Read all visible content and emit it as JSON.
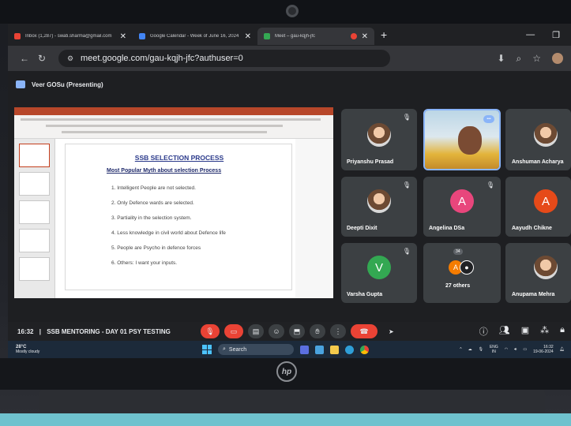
{
  "browser": {
    "tabs": [
      {
        "title": "Inbox (1,287) - swati.sharma@gmail.com",
        "favicon_color": "#ea4335",
        "active": false
      },
      {
        "title": "Google Calendar - Week of June 16, 2024",
        "favicon_color": "#4285f4",
        "active": false
      },
      {
        "title": "Meet – gau-kqjh-jfc",
        "favicon_color": "#34a853",
        "active": true
      }
    ],
    "close_glyph": "✕",
    "new_tab_glyph": "+",
    "window_controls": [
      "—",
      "❐"
    ],
    "url": "meet.google.com/gau-kqjh-jfc?authuser=0"
  },
  "meet": {
    "presenter_label": "Veer GOSu (Presenting)",
    "meeting_time": "16:32",
    "meeting_separator": "|",
    "meeting_name": "SSB MENTORING - DAY 01 PSY TESTING",
    "others_count_label": "27 others",
    "hand_count": "34",
    "participants": [
      {
        "name": "Priyanshu Prasad",
        "type": "photo",
        "muted": true
      },
      {
        "name": "",
        "type": "video",
        "muted": false,
        "active_speaker": true
      },
      {
        "name": "Anshuman Acharya",
        "type": "photo",
        "muted": true
      },
      {
        "name": "Deepti Dixit",
        "type": "photo",
        "muted": true
      },
      {
        "name": "Angelina DSa",
        "type": "letter",
        "letter": "A",
        "color": "#e8467c",
        "muted": true
      },
      {
        "name": "Aayudh Chikne",
        "type": "letter",
        "letter": "A",
        "color": "#e64a19",
        "muted": true
      },
      {
        "name": "Varsha Gupta",
        "type": "letter",
        "letter": "V",
        "color": "#33a852",
        "muted": true
      },
      {
        "name": "Anupama Mehra",
        "type": "photo",
        "muted": true
      }
    ],
    "others_avatars": [
      {
        "letter": "A",
        "color": "#f57c00"
      },
      {
        "letter": "●",
        "color": "#202124"
      }
    ]
  },
  "slide": {
    "title": "SSB SELECTION PROCESS",
    "subtitle": "Most Popular Myth about selection Process",
    "items": [
      "1.  Intelligent People are not selected.",
      "2.  Only Defence wards are selected.",
      "3.  Partiality in the selection system.",
      "4.  Less knowledge in civil world about Defence life",
      "5.  People are Psycho in defence forces",
      "6.  Others: I want your inputs."
    ]
  },
  "taskbar": {
    "weather_temp": "28°C",
    "weather_desc": "Mostly cloudy",
    "search_label": "Search",
    "lang_top": "ENG",
    "lang_bottom": "IN",
    "time": "16:32",
    "date": "19-06-2024"
  },
  "hardware": {
    "brand": "hp"
  },
  "colors": {
    "meet_bg": "#1e1f22",
    "tile_bg": "#3c4043",
    "end_call": "#ea4335",
    "active_border": "#8ab4f8"
  }
}
